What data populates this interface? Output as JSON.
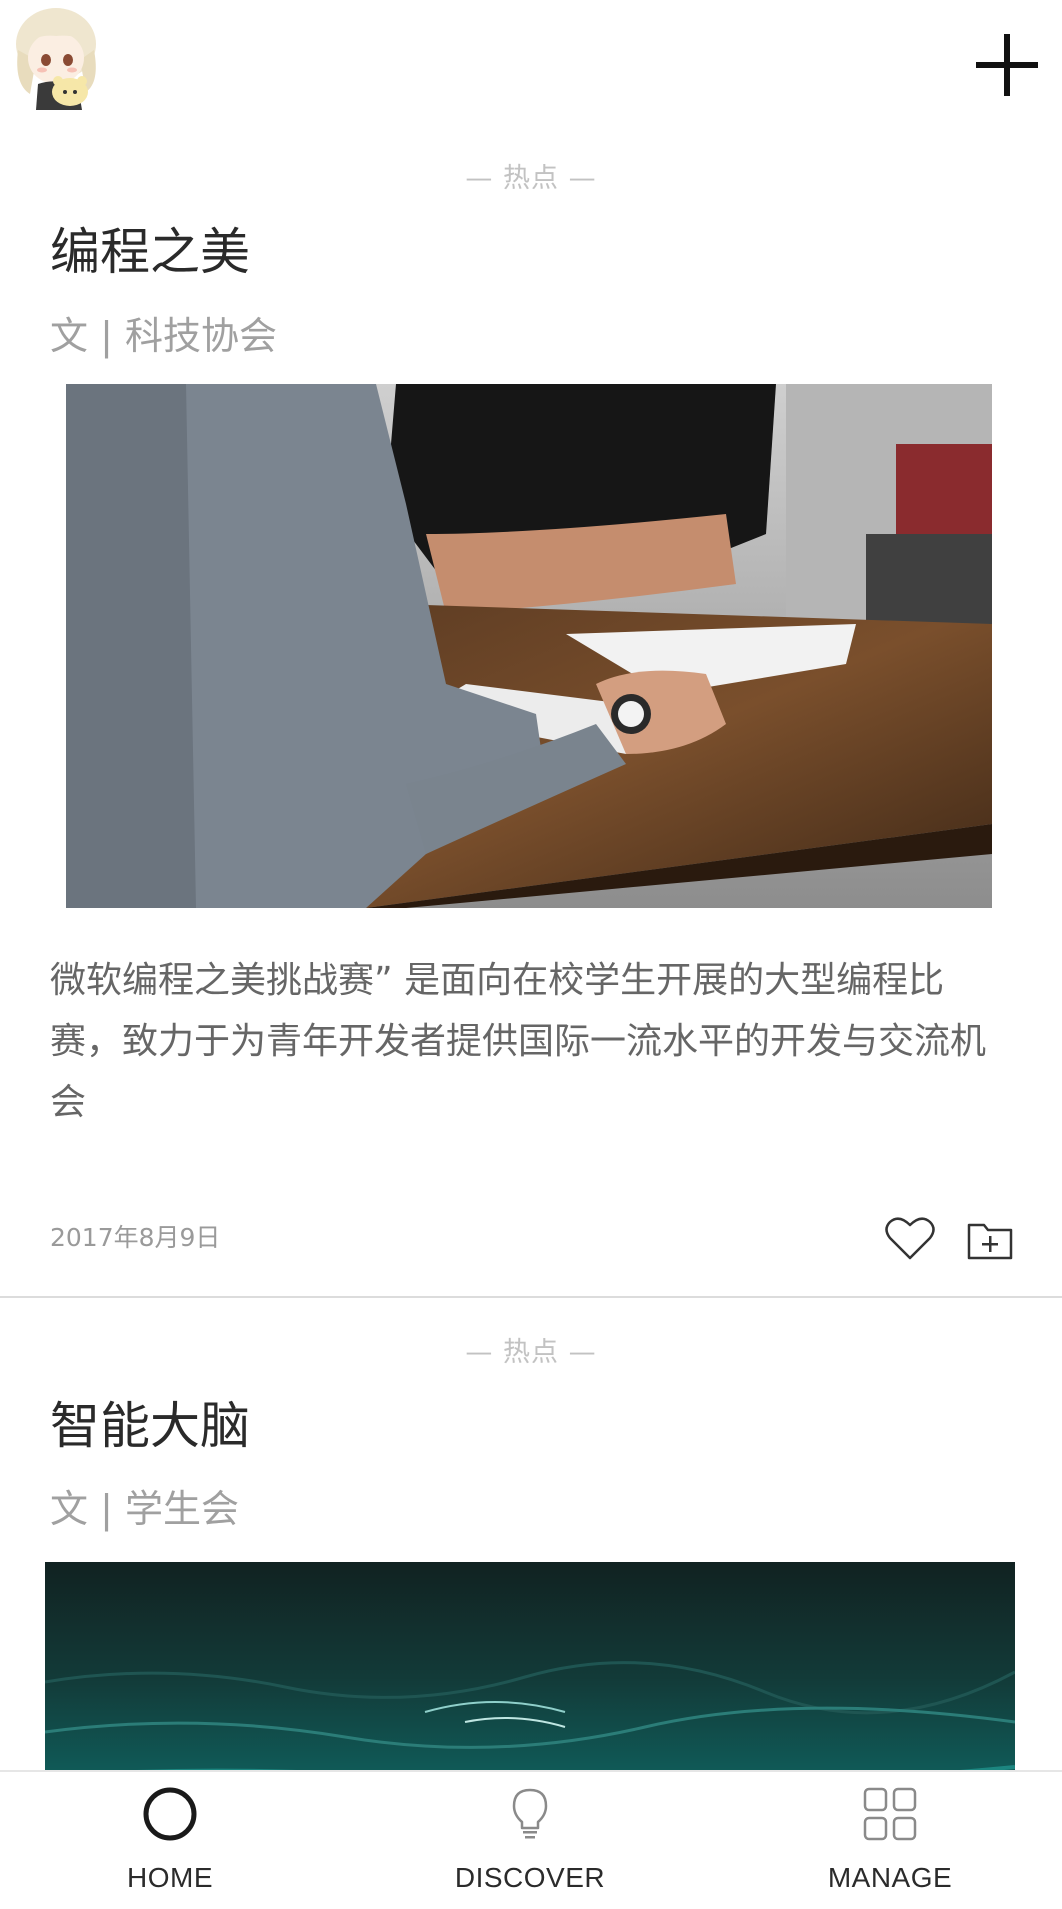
{
  "header": {
    "avatar_icon": "anime-avatar",
    "add_icon": "plus-icon"
  },
  "feed": [
    {
      "tag": "— 热点 —",
      "title": "编程之美",
      "author": "文 |  科技协会",
      "image": "office-meeting-photo",
      "description": "微软编程之美挑战赛” 是面向在校学生开展的大型编程比赛，致力于为青年开发者提供国际一流水平的开发与交流机会",
      "date": "2017年8月9日",
      "like_icon": "heart-icon",
      "save_icon": "folder-add-icon"
    },
    {
      "tag": "— 热点 —",
      "title": "智能大脑",
      "author": "文 | 学生会",
      "image": "ocean-water-photo"
    }
  ],
  "tabbar": {
    "tabs": [
      {
        "label": "HOME",
        "icon": "circle-icon",
        "active": true
      },
      {
        "label": "DISCOVER",
        "icon": "lightbulb-icon",
        "active": false
      },
      {
        "label": "MANAGE",
        "icon": "grid-icon",
        "active": false
      }
    ]
  },
  "colors": {
    "background": "#ffffff",
    "tag_text": "#c2c2c2",
    "title_text": "#2a2a2a",
    "meta_text": "#a0a0a0",
    "body_text": "#666666",
    "divider": "#dcdcdc"
  }
}
